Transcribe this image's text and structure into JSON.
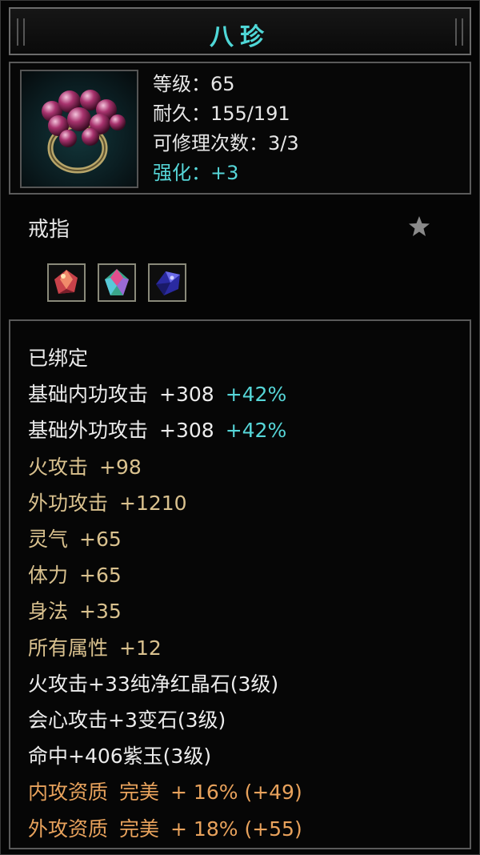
{
  "title": "八珍",
  "item": {
    "icon": "ring-icon",
    "level": "等级：65",
    "durability": "耐久：155/191",
    "repairs": "可修理次数：3/3",
    "enhance": "强化：+3"
  },
  "type": "戒指",
  "favorite_icon": "star-icon",
  "gems": [
    "red-gem-icon",
    "multicolor-gem-icon",
    "purple-gem-icon"
  ],
  "attributes": {
    "bound": "已绑定",
    "rows": [
      {
        "label": "基础内功攻击",
        "value": "+308",
        "extra": "+42%"
      },
      {
        "label": "基础外功攻击",
        "value": "+308",
        "extra": "+42%"
      },
      {
        "label": "火攻击",
        "value": "+98"
      },
      {
        "label": "外功攻击",
        "value": "+1210"
      },
      {
        "label": "灵气",
        "value": "+65"
      },
      {
        "label": "体力",
        "value": "+65"
      },
      {
        "label": "身法",
        "value": "+35"
      },
      {
        "label": "所有属性",
        "value": "+12"
      }
    ],
    "socketed": [
      "火攻击+33纯净红晶石(3级)",
      "会心攻击+3变石(3级)",
      "命中+406紫玉(3级)"
    ],
    "quality": [
      {
        "label": "内攻资质",
        "grade": "完美",
        "text": "+ 16% (+49)"
      },
      {
        "label": "外攻资质",
        "grade": "完美",
        "text": "+ 18% (+55)"
      }
    ]
  },
  "colors": {
    "title": "#4fd7d7",
    "cyan": "#56d6d8",
    "gold": "#d9c18e",
    "orange": "#e8a25c",
    "white": "#ececec"
  }
}
